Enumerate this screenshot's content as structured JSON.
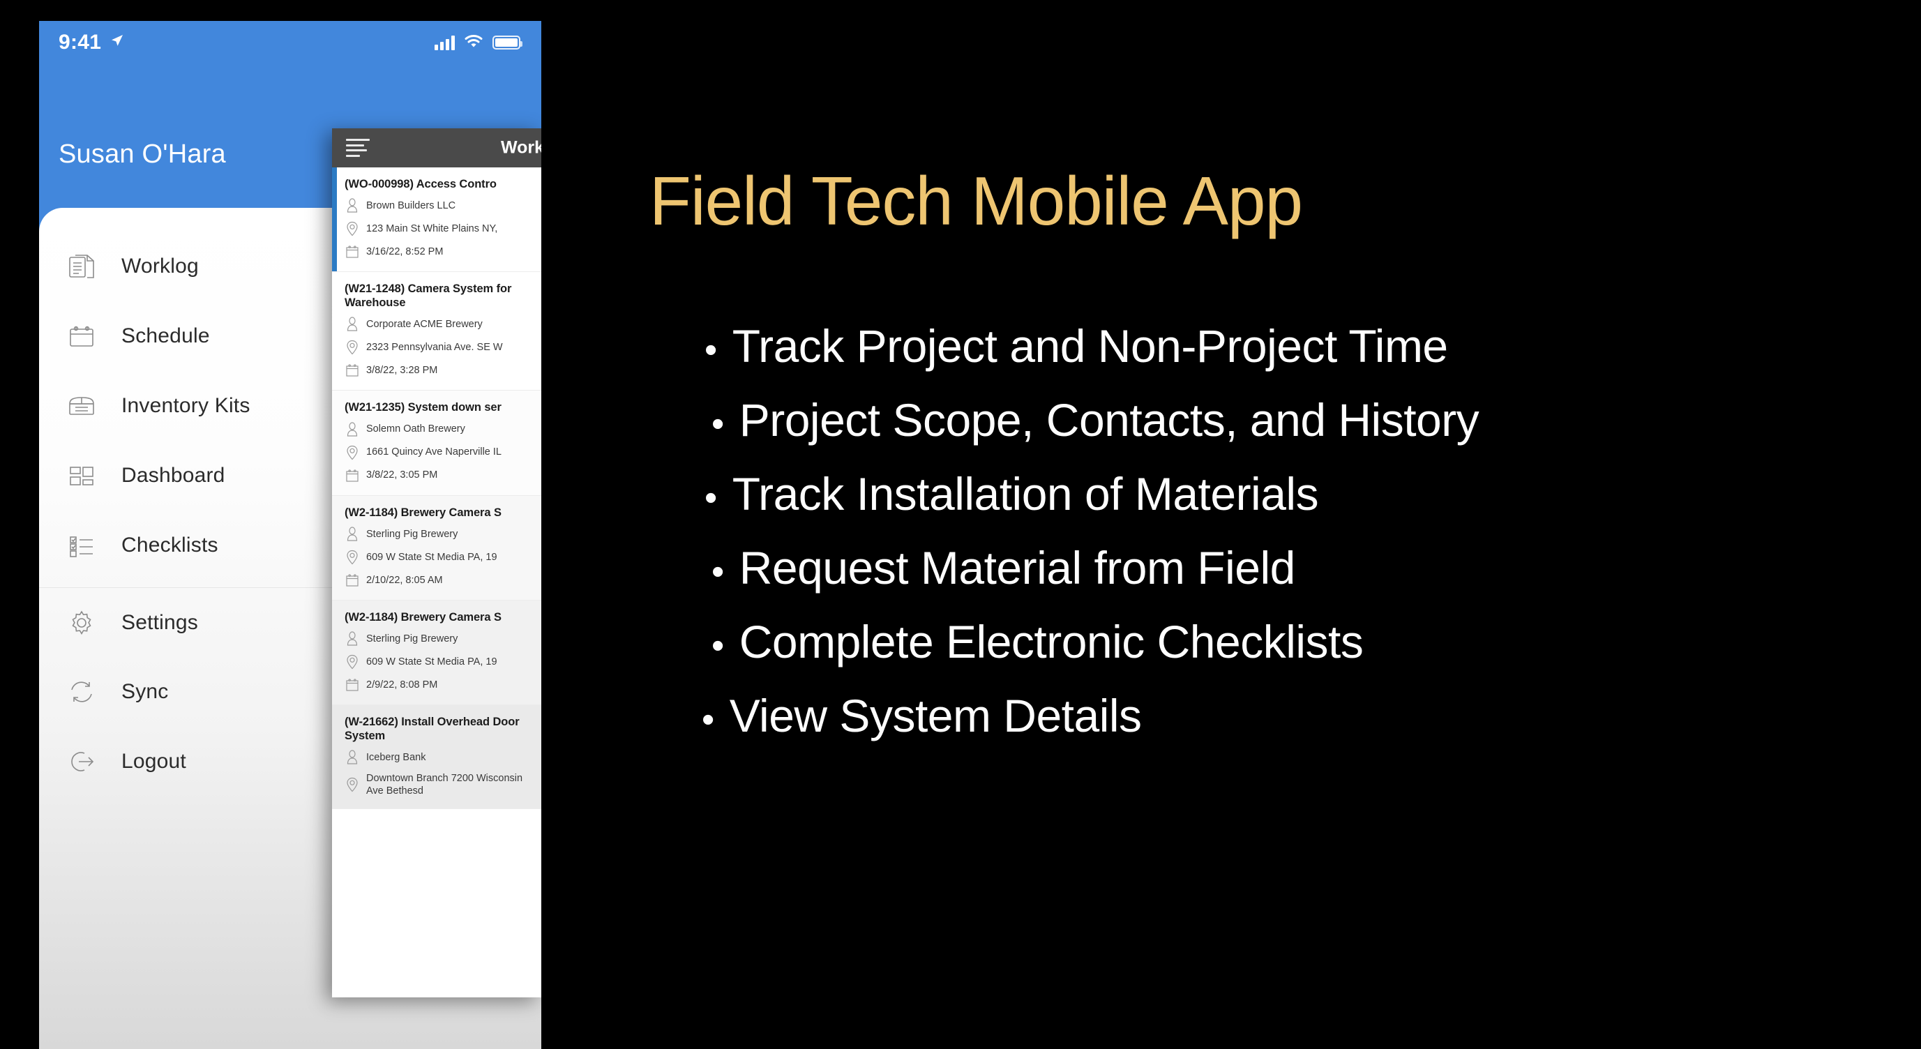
{
  "phone": {
    "statusbar": {
      "time": "9:41",
      "location_icon": "location-arrow-icon",
      "signal_icon": "cellular-signal-icon",
      "wifi_icon": "wifi-icon",
      "battery_icon": "battery-icon"
    },
    "user_name": "Susan O'Hara",
    "menu": [
      {
        "label": "Worklog",
        "icon": "document-icon"
      },
      {
        "label": "Schedule",
        "icon": "calendar-icon"
      },
      {
        "label": "Inventory Kits",
        "icon": "box-icon"
      },
      {
        "label": "Dashboard",
        "icon": "dashboard-grid-icon"
      },
      {
        "label": "Checklists",
        "icon": "checklist-icon"
      },
      {
        "label": "Settings",
        "icon": "gear-icon"
      },
      {
        "label": "Sync",
        "icon": "sync-refresh-icon"
      },
      {
        "label": "Logout",
        "icon": "logout-arrow-icon"
      }
    ]
  },
  "worklist": {
    "menu_icon": "hamburger-menu-icon",
    "header_title": "Work",
    "person_icon": "person-icon",
    "location_icon": "map-pin-icon",
    "date_icon": "calendar-icon",
    "items": [
      {
        "name": "(WO-000998) Access Contro",
        "customer": "Brown Builders LLC",
        "address": "123 Main St White Plains NY,",
        "date": "3/16/22, 8:52 PM"
      },
      {
        "name": "(W21-1248) Camera System for Warehouse",
        "customer": "Corporate ACME Brewery",
        "address": "2323 Pennsylvania Ave. SE W",
        "date": "3/8/22, 3:28 PM"
      },
      {
        "name": "(W21-1235) System down ser",
        "customer": "Solemn Oath Brewery",
        "address": "1661 Quincy Ave Naperville IL",
        "date": "3/8/22, 3:05 PM"
      },
      {
        "name": "(W2-1184) Brewery Camera S",
        "customer": "Sterling Pig Brewery",
        "address": "609 W State St Media PA, 19",
        "date": "2/10/22, 8:05 AM"
      },
      {
        "name": "(W2-1184) Brewery Camera S",
        "customer": "Sterling Pig Brewery",
        "address": "609 W State St Media PA, 19",
        "date": "2/9/22, 8:08 PM"
      },
      {
        "name": "(W-21662) Install Overhead Door System",
        "customer": "Iceberg Bank",
        "address": "Downtown Branch\n7200 Wisconsin Ave Bethesd",
        "date": ""
      }
    ]
  },
  "slide": {
    "title": "Field Tech Mobile App",
    "bullet_marker": "•",
    "bullets": [
      "Track Project and Non-Project Time",
      "Project Scope, Contacts, and History",
      "Track Installation of Materials",
      "Request Material from Field",
      "Complete Electronic Checklists",
      "View System Details"
    ]
  },
  "colors": {
    "background": "#000000",
    "phone_header_blue": "#4287DC",
    "list_header_gray": "#4A4A4A",
    "accent_strip_blue": "#2C7BC4",
    "title_gold": "#EEC571",
    "bullet_white": "#FDFDFD"
  }
}
